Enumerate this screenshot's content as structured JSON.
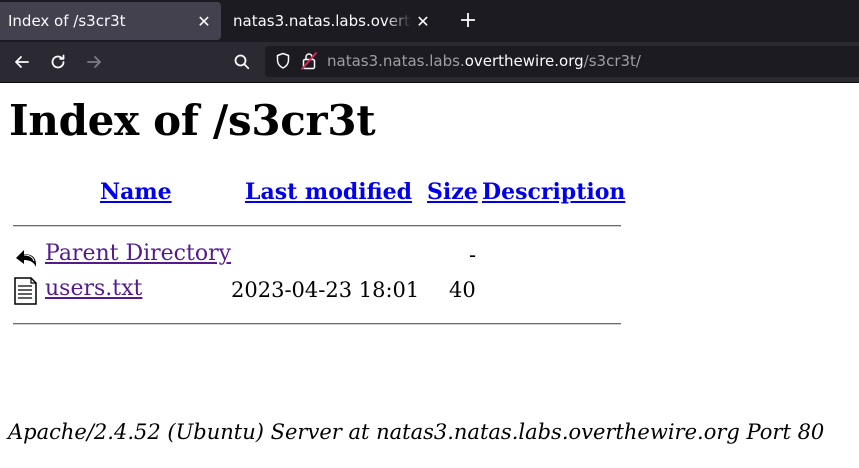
{
  "browser": {
    "tabs": [
      {
        "title": "Index of /s3cr3t",
        "active": true
      },
      {
        "title": "natas3.natas.labs.overthewire.org",
        "active": false
      }
    ],
    "new_tab_icon": "plus-icon",
    "url": {
      "prefix": "natas3.natas.labs.",
      "host": "overthewire.org",
      "path": "/s3cr3t/"
    }
  },
  "page": {
    "title": "Index of /s3cr3t",
    "columns": {
      "name": "Name",
      "last_modified": "Last modified",
      "size": "Size",
      "description": "Description"
    },
    "rows": [
      {
        "icon": "back-arrow-icon",
        "name": "Parent Directory",
        "last_modified": "",
        "size": "-"
      },
      {
        "icon": "text-file-icon",
        "name": "users.txt",
        "last_modified": "2023-04-23 18:01",
        "size": "40"
      }
    ],
    "address": "Apache/2.4.52 (Ubuntu) Server at natas3.natas.labs.overthewire.org Port 80"
  }
}
